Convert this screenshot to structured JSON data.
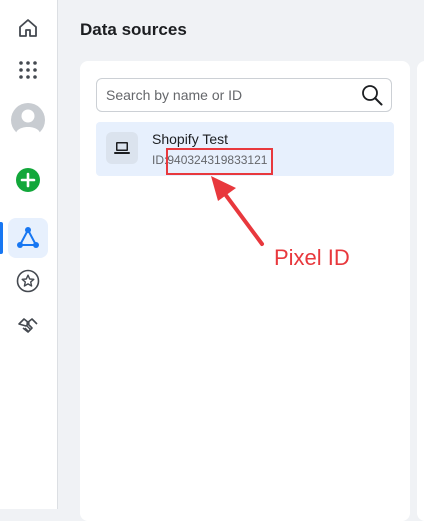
{
  "nav": {
    "items": [
      {
        "icon": "home-icon",
        "active": false
      },
      {
        "icon": "grid-apps-icon",
        "active": false
      },
      {
        "icon": "avatar",
        "active": false
      },
      {
        "icon": "plus-circle-icon",
        "active": false,
        "color": "#12a73a"
      },
      {
        "icon": "data-sources-icon",
        "active": true,
        "color": "#1877f2"
      },
      {
        "icon": "star-circle-icon",
        "active": false
      },
      {
        "icon": "handshake-icon",
        "active": false
      }
    ]
  },
  "page": {
    "title": "Data sources"
  },
  "search": {
    "placeholder": "Search by name or ID",
    "value": ""
  },
  "sources": [
    {
      "name": "Shopify Test",
      "id_label": "ID:",
      "id": "940324319833121",
      "icon": "laptop-icon",
      "selected": true
    }
  ],
  "annotation": {
    "label": "Pixel ID",
    "color": "#e8383d"
  },
  "colors": {
    "accent": "#1877f2",
    "selected_bg": "#e7f0fd",
    "annotation": "#e8383d"
  }
}
